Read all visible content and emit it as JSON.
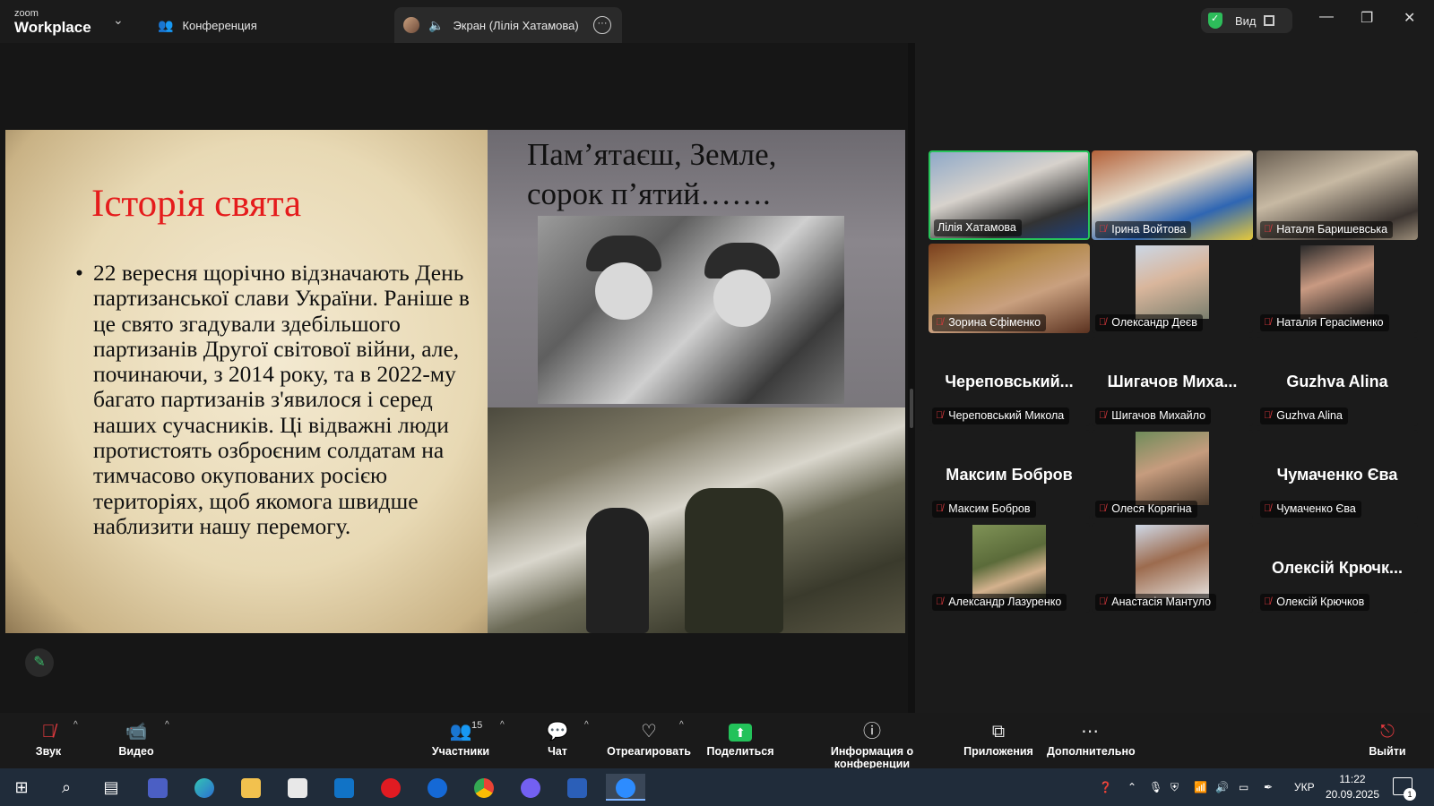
{
  "titlebar": {
    "logo_small": "zoom",
    "logo_big": "Workplace",
    "tab_conference": "Конференция",
    "tab_screen": "Экран (Лілія Хатамова)",
    "view_label": "Вид"
  },
  "slide": {
    "title": "Історія свята",
    "bullet": "22 вересня щорічно відзначають День партизанської слави України. Раніше в це свято згадували здебільшого партизанів Другої світової війни, але, починаючи, з 2014 року, та в 2022-му багато партизанів з'явилося і серед наших сучасників. Ці відважні люди протистоять озброєним солдатам на тимчасово окупованих росією територіях, щоб якомога швидше наблизити нашу перемогу.",
    "quote_line1": "Пам’ятаєш, Земле,",
    "quote_line2": "сорок п’ятий……."
  },
  "participants": [
    {
      "label": "Лілія Хатамова",
      "display": "",
      "muted": false,
      "video": true,
      "active": true
    },
    {
      "label": "Ірина Войтова",
      "display": "",
      "muted": true,
      "video": true
    },
    {
      "label": "Наталя Баришевська",
      "display": "",
      "muted": true,
      "video": true
    },
    {
      "label": "Зорина  Єфіменко",
      "display": "",
      "muted": true,
      "video": true
    },
    {
      "label": "Олександр Деєв",
      "display": "",
      "muted": true,
      "video": true
    },
    {
      "label": "Наталія Герасіменко",
      "display": "",
      "muted": true,
      "video": true
    },
    {
      "label": "Череповський Микола",
      "display": "Череповський...",
      "muted": true,
      "video": false
    },
    {
      "label": "Шигачов Михайло",
      "display": "Шигачов  Миха...",
      "muted": true,
      "video": false
    },
    {
      "label": "Guzhva Alina",
      "display": "Guzhva Alina",
      "muted": true,
      "video": false
    },
    {
      "label": "Максим Бобров",
      "display": "Максим Бобров",
      "muted": true,
      "video": false
    },
    {
      "label": "Олеся Корягіна",
      "display": "",
      "muted": true,
      "video": true
    },
    {
      "label": "Чумаченко Єва",
      "display": "Чумаченко Єва",
      "muted": true,
      "video": false
    },
    {
      "label": "Александр Лазуренко",
      "display": "",
      "muted": true,
      "video": true
    },
    {
      "label": "Анастасія Мантуло",
      "display": "",
      "muted": true,
      "video": true
    },
    {
      "label": "Олексій Крючков",
      "display": "Олексій Крючк...",
      "muted": true,
      "video": false
    }
  ],
  "toolbar": {
    "audio": "Звук",
    "video": "Видео",
    "participants": "Участники",
    "participants_count": "15",
    "chat": "Чат",
    "react": "Отреагировать",
    "share": "Поделиться",
    "info": "Информация о конференции",
    "apps": "Приложения",
    "more": "Дополнительно",
    "leave": "Выйти"
  },
  "taskbar": {
    "lang": "УКР",
    "time": "11:22",
    "date": "20.09.2025",
    "notif_count": "1"
  },
  "colors": {
    "active_border": "#27c45a",
    "mic_off": "#e0393e",
    "share_green": "#23c25a",
    "slide_title_red": "#e51c1c"
  }
}
